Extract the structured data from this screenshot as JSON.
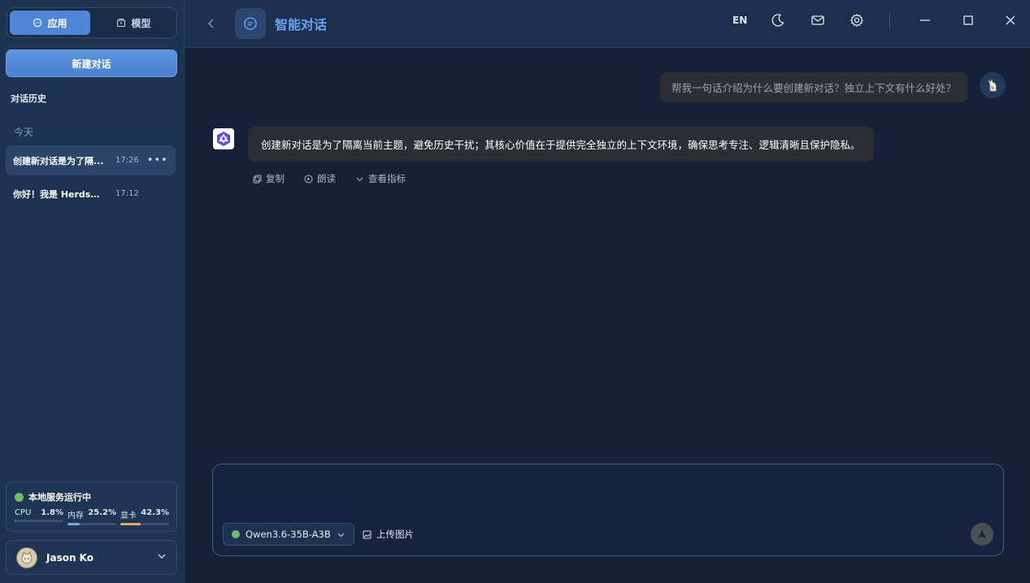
{
  "sidebar": {
    "tabs": [
      {
        "label": "应用",
        "icon": "chat-bubble-icon",
        "active": true
      },
      {
        "label": "模型",
        "icon": "cube-icon",
        "active": false
      }
    ],
    "new_chat_label": "新建对话",
    "history_title": "对话历史",
    "group_today": "今天",
    "history": [
      {
        "title": "创建新对话是为了隔...",
        "time": "17:26",
        "more": "•••",
        "active": true
      },
      {
        "title": "你好！我是 Herdsm...",
        "time": "17:12",
        "active": false
      }
    ],
    "status": {
      "title": "本地服务运行中",
      "color": "#6bbd6e",
      "metrics": [
        {
          "label": "CPU",
          "value": "1.8%",
          "pct": 1.8,
          "color": "#5b8fd9"
        },
        {
          "label": "内存",
          "value": "25.2%",
          "pct": 25.2,
          "color": "#7aa6e8"
        },
        {
          "label": "显卡",
          "value": "42.3%",
          "pct": 42.3,
          "color": "#e0a85a"
        }
      ]
    },
    "user": {
      "name": "Jason Ko",
      "avatar_icon": "cat-avatar-icon",
      "chevron": "chevron-down-icon"
    }
  },
  "topbar": {
    "back_icon": "chevron-left-icon",
    "app_icon": "chat-bubble-icon",
    "title": "智能对话",
    "lang": "EN",
    "icons": [
      "moon-icon",
      "mail-icon",
      "gear-icon",
      "minimize-icon",
      "maximize-icon",
      "close-icon"
    ]
  },
  "chat": {
    "messages": [
      {
        "role": "user",
        "text": "帮我一句话介绍为什么要创建新对话？独立上下文有什么好处？",
        "avatar_icon": "llama-avatar-icon"
      },
      {
        "role": "assistant",
        "text": "创建新对话是为了隔离当前主题，避免历史干扰；其核心价值在于提供完全独立的上下文环境，确保思考专注、逻辑清晰且保护隐私。",
        "avatar_icon": "qwen-logo-icon"
      }
    ],
    "actions": [
      {
        "label": "复制",
        "icon": "copy-icon"
      },
      {
        "label": "朗读",
        "icon": "play-icon"
      },
      {
        "label": "查看指标",
        "icon": "chevron-down-icon"
      }
    ]
  },
  "composer": {
    "placeholder": "",
    "model": "Qwen3.6-35B-A3B",
    "model_status_color": "#6bbd6e",
    "upload_label": "上传图片",
    "send_icon": "send-arrow-icon"
  },
  "colors": {
    "accent": "#4f87d6",
    "background": "#142139",
    "sidebar": "#1d3150"
  }
}
